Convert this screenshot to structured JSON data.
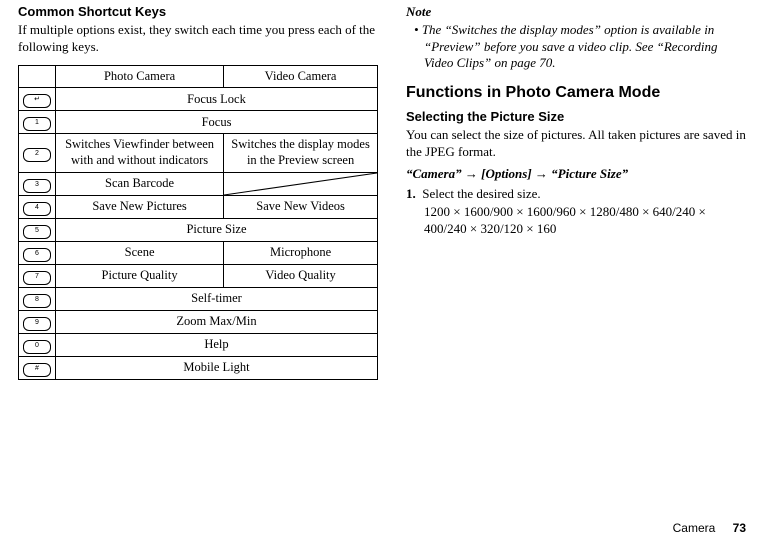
{
  "left": {
    "heading": "Common Shortcut Keys",
    "intro": "If multiple options exist, they switch each time you press each of the following keys.",
    "table": {
      "head_photo": "Photo Camera",
      "head_video": "Video Camera",
      "rows": {
        "r0_key": "↵",
        "r0_span": "Focus Lock",
        "r1_key": "1",
        "r1_span": "Focus",
        "r2_key": "2",
        "r2_photo": "Switches Viewfinder between with and without indicators",
        "r2_video": "Switches the display modes in the Preview screen",
        "r3_key": "3",
        "r3_photo": "Scan Barcode",
        "r4_key": "4",
        "r4_photo": "Save New Pictures",
        "r4_video": "Save New Videos",
        "r5_key": "5",
        "r5_span": "Picture Size",
        "r6_key": "6",
        "r6_photo": "Scene",
        "r6_video": "Microphone",
        "r7_key": "7",
        "r7_photo": "Picture Quality",
        "r7_video": "Video Quality",
        "r8_key": "8",
        "r8_span": "Self-timer",
        "r9_key": "9",
        "r9_span": "Zoom Max/Min",
        "r10_key": "0",
        "r10_span": "Help",
        "r11_key": "#",
        "r11_span": "Mobile Light"
      }
    }
  },
  "right": {
    "note_head": "Note",
    "note_body": "The “Switches the display modes” option is available in “Preview” before you save a video clip. See “Recording Video Clips” on page 70.",
    "fn_head": "Functions in Photo Camera Mode",
    "sel_head": "Selecting the Picture Size",
    "sel_body": "You can select the size of pictures. All taken pictures are saved in the JPEG format.",
    "path": "“Camera” → [Options] → “Picture Size”",
    "step_num": "1.",
    "step_text": "Select the desired size.",
    "sizes": "1200 × 1600/900 × 1600/960 × 1280/480 × 640/240 × 400/240 × 320/120 × 160"
  },
  "footer": {
    "section": "Camera",
    "page": "73"
  }
}
